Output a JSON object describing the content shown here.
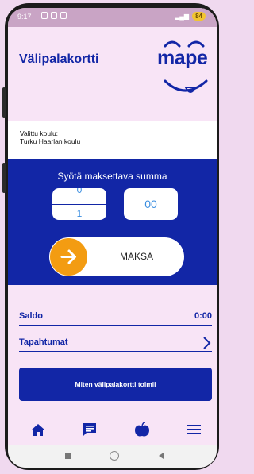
{
  "status": {
    "time": "9:17",
    "battery": "84"
  },
  "header": {
    "title": "Välipalakortti",
    "logo_text": "mape"
  },
  "school": {
    "label": "Valittu koulu:",
    "name": "Turku Haarlan koulu"
  },
  "payment": {
    "title": "Syötä maksettava summa",
    "euros_above": "0",
    "euros_below": "1",
    "cents": "00",
    "pay_label": "MAKSA"
  },
  "account": {
    "balance_label": "Saldo",
    "balance_value": "0:00",
    "transactions_label": "Tapahtumat"
  },
  "help": {
    "label": "Miten välipalakortti toimii"
  },
  "nav": {
    "items": [
      {
        "icon": "home-icon"
      },
      {
        "icon": "message-icon"
      },
      {
        "icon": "apple-icon"
      },
      {
        "icon": "menu-icon"
      }
    ]
  },
  "colors": {
    "brand": "#1226a6",
    "accent": "#f39c12",
    "background": "#f8e4f6"
  }
}
